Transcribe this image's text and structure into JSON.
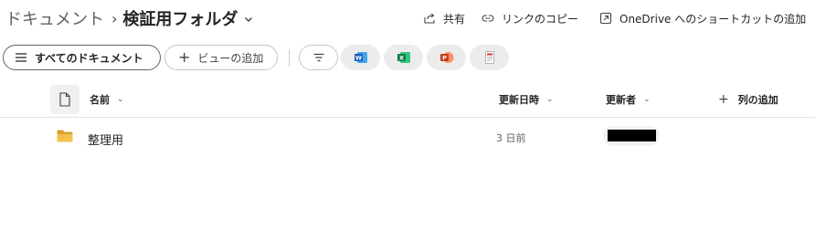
{
  "breadcrumb": {
    "root": "ドキュメント",
    "separator": "›",
    "current": "検証用フォルダ"
  },
  "header_actions": {
    "share": "共有",
    "copy_link": "リンクのコピー",
    "shortcut": "OneDrive へのショートカットの追加"
  },
  "commandbar": {
    "all_documents": "すべてのドキュメント",
    "add_view": "ビューの追加"
  },
  "columns": {
    "name": "名前",
    "modified": "更新日時",
    "modified_by": "更新者",
    "add_column": "列の追加"
  },
  "rows": [
    {
      "name": "整理用",
      "modified": "3 日前"
    }
  ],
  "icons": {
    "share": "share-icon",
    "link": "link-icon",
    "shortcut": "shortcut-icon",
    "filter": "filter-icon",
    "word": "word-icon",
    "excel": "excel-icon",
    "powerpoint": "powerpoint-icon",
    "other": "document-icon",
    "folder": "folder-icon"
  },
  "colors": {
    "word": "#185abd",
    "excel": "#107c41",
    "powerpoint": "#c43e1c",
    "folder": "#f2b93b"
  }
}
